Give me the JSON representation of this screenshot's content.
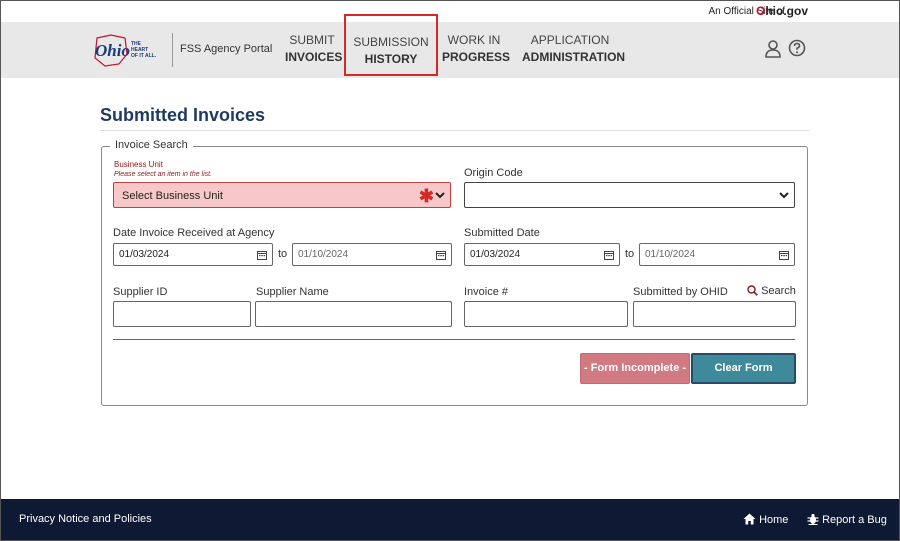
{
  "official": {
    "text": "An Official Site of",
    "brand_o": "O",
    "brand_rest": "hio.gov"
  },
  "header": {
    "logo_text": "Ohio",
    "logo_tagline": "THE HEART OF IT ALL.",
    "portal_name": "FSS Agency Portal",
    "nav": [
      {
        "line1": "SUBMIT",
        "line2": "INVOICES"
      },
      {
        "line1": "SUBMISSION",
        "line2": "HISTORY"
      },
      {
        "line1": "WORK IN",
        "line2": "PROGRESS"
      },
      {
        "line1": "APPLICATION",
        "line2": "ADMINISTRATION"
      }
    ]
  },
  "main": {
    "title": "Submitted Invoices",
    "legend": "Invoice Search",
    "business_unit": {
      "label": "Business Unit",
      "error": "Please select an item in the list.",
      "value": "Select Business Unit"
    },
    "origin_code": {
      "label": "Origin Code",
      "value": ""
    },
    "date_received": {
      "label": "Date Invoice Received at Agency",
      "from": "01/03/2024",
      "to_label": "to",
      "to": "01/10/2024"
    },
    "submitted_date": {
      "label": "Submitted Date",
      "from": "01/03/2024",
      "to_label": "to",
      "to": "01/10/2024"
    },
    "supplier_id": {
      "label": "Supplier ID",
      "value": ""
    },
    "supplier_name": {
      "label": "Supplier Name",
      "value": ""
    },
    "invoice_number": {
      "label": "Invoice #",
      "value": ""
    },
    "submitted_by": {
      "label": "Submitted by OHID",
      "value": ""
    },
    "search_link": "Search",
    "btn_incomplete": "- Form Incomplete -",
    "btn_clear": "Clear Form"
  },
  "footer": {
    "privacy": "Privacy Notice and Policies",
    "home": "Home",
    "bug": "Report a Bug"
  },
  "colors": {
    "title": "#1f3a5f",
    "error_field": "#f8c8c8",
    "required": "#d62828",
    "clear_button": "#3f8a9a",
    "incomplete_button": "#d27a82",
    "footer": "#0e1a33"
  }
}
